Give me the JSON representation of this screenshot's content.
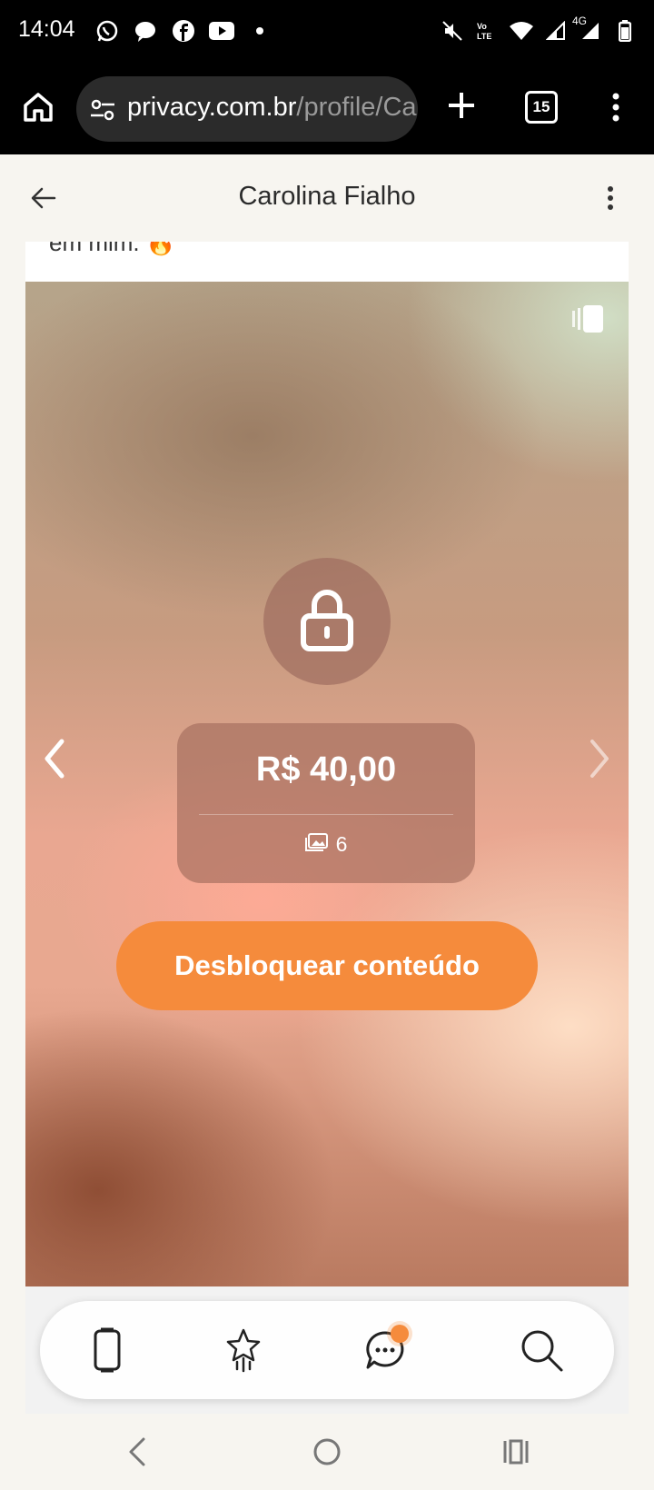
{
  "status_bar": {
    "time": "14:04",
    "left_icons": [
      "whatsapp-icon",
      "messenger-icon",
      "facebook-icon",
      "youtube-icon",
      "dot-icon"
    ],
    "right_icons": [
      "mute-icon",
      "volte-icon",
      "wifi-icon",
      "signal-icon",
      "4g-signal-icon",
      "battery-icon"
    ],
    "network": "4G"
  },
  "browser": {
    "url_domain": "privacy.com.br",
    "url_path": "/profile/Ca",
    "tab_count": "15"
  },
  "header": {
    "title": "Carolina Fialho"
  },
  "post": {
    "caption_fragment": "em mim. 🔥",
    "price": "R$ 40,00",
    "media_count": "6",
    "unlock_label": "Desbloquear conteúdo"
  },
  "colors": {
    "accent": "#f58b3c",
    "background": "#f7f5f0"
  },
  "bottom_nav": {
    "items": [
      "feed-icon",
      "star-icon",
      "chat-icon",
      "search-icon"
    ]
  },
  "system_nav": [
    "back-icon",
    "home-icon",
    "recents-icon"
  ]
}
